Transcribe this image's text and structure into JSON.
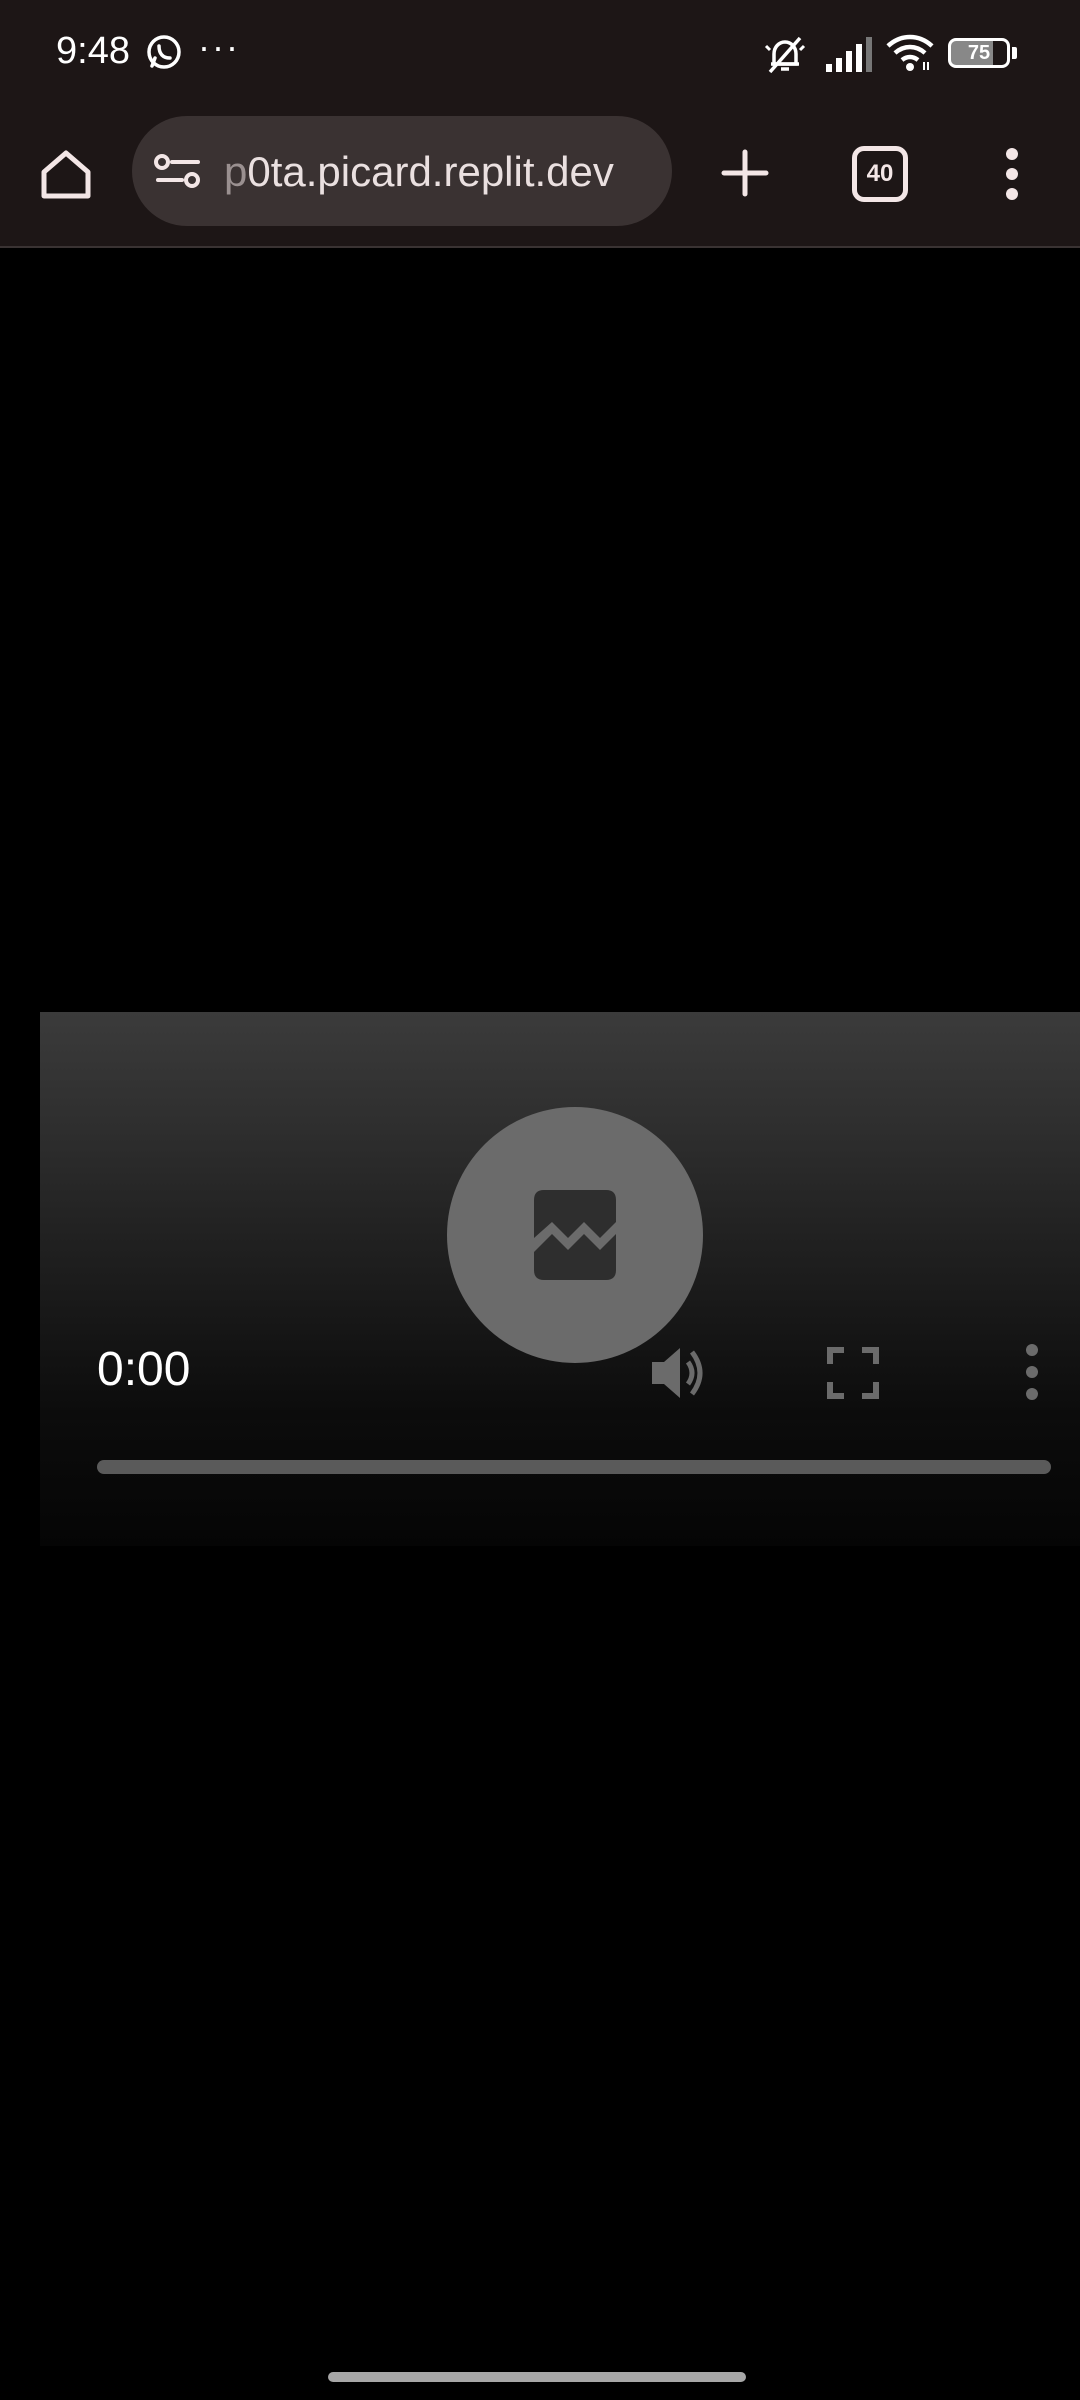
{
  "status_bar": {
    "time": "9:48",
    "more_glyph": "···",
    "battery_level": "75",
    "icons": [
      "whatsapp-icon",
      "mute-icon",
      "signal-icon",
      "wifi-icon",
      "battery-icon"
    ]
  },
  "toolbar": {
    "url_faded": "p",
    "url_main": "0ta.picard.replit.dev",
    "tab_count": "40",
    "icons": [
      "home-icon",
      "site-settings-icon",
      "plus-icon",
      "tabs-icon",
      "more-vert-icon"
    ]
  },
  "video": {
    "current_time": "0:00",
    "progress": 0,
    "icons": [
      "broken-image-icon",
      "volume-icon",
      "fullscreen-icon",
      "more-vert-icon"
    ]
  },
  "colors": {
    "chrome_bg": "#1d1616",
    "omnibox_bg": "#3a3232",
    "page_bg": "#000000"
  }
}
